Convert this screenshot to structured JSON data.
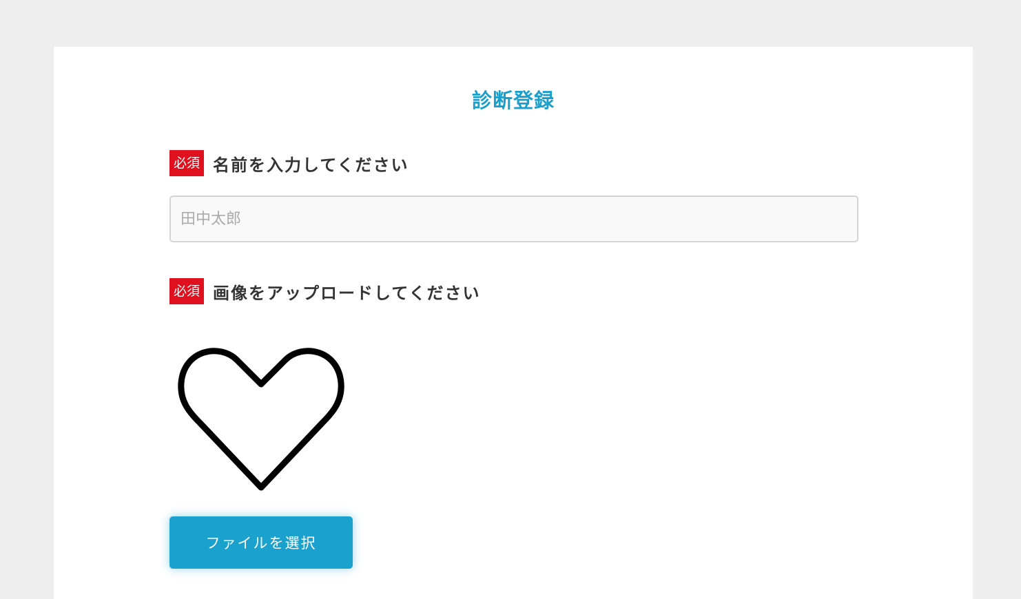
{
  "form": {
    "title": "診断登録",
    "name_field": {
      "required_badge": "必須",
      "label": "名前を入力してください",
      "placeholder": "田中太郎",
      "value": ""
    },
    "image_field": {
      "required_badge": "必須",
      "label": "画像をアップロードしてください",
      "preview_icon": "heart-outline-icon"
    },
    "file_button_label": "ファイルを選択"
  },
  "colors": {
    "background": "#eeeeee",
    "card": "#ffffff",
    "accent": "#1a9fcc",
    "required": "#e0101f",
    "label_text": "#333333"
  }
}
